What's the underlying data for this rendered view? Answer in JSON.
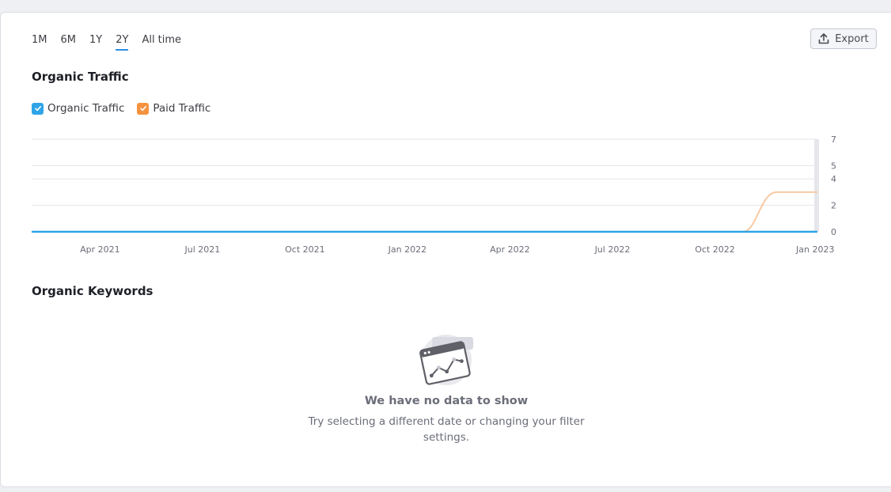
{
  "period_tabs": [
    {
      "label": "1M",
      "active": false
    },
    {
      "label": "6M",
      "active": false
    },
    {
      "label": "1Y",
      "active": false
    },
    {
      "label": "2Y",
      "active": true
    },
    {
      "label": "All time",
      "active": false
    }
  ],
  "export": {
    "label": "Export",
    "icon": "upload-icon"
  },
  "traffic_section": {
    "title": "Organic Traffic"
  },
  "legend": [
    {
      "label": "Organic Traffic",
      "color": "#2fa5e8",
      "checked": true
    },
    {
      "label": "Paid Traffic",
      "color": "#f5923e",
      "checked": true
    }
  ],
  "chart_data": {
    "type": "line",
    "x_ticks": [
      "Apr 2021",
      "Jul 2021",
      "Oct 2021",
      "Jan 2022",
      "Apr 2022",
      "Jul 2022",
      "Oct 2022",
      "Jan 2023"
    ],
    "y_ticks": [
      0,
      2,
      4,
      5,
      7
    ],
    "ylim": [
      0,
      7
    ],
    "xlim": [
      "2021-02",
      "2023-01"
    ],
    "grid": true,
    "series": [
      {
        "name": "Organic Traffic",
        "color": "#2fa5e8",
        "points": [
          [
            "2021-02",
            0
          ],
          [
            "2023-01",
            0
          ]
        ]
      },
      {
        "name": "Paid Traffic",
        "color": "#f8c9a3",
        "points": [
          [
            "2021-02",
            0
          ],
          [
            "2022-11",
            0
          ],
          [
            "2022-12",
            3
          ],
          [
            "2023-01",
            3
          ]
        ]
      }
    ]
  },
  "keywords_section": {
    "title": "Organic Keywords",
    "empty_icon": "no-data-chart-icon",
    "empty_title": "We have no data to show",
    "empty_subtitle": "Try selecting a different date or changing your filter settings."
  }
}
